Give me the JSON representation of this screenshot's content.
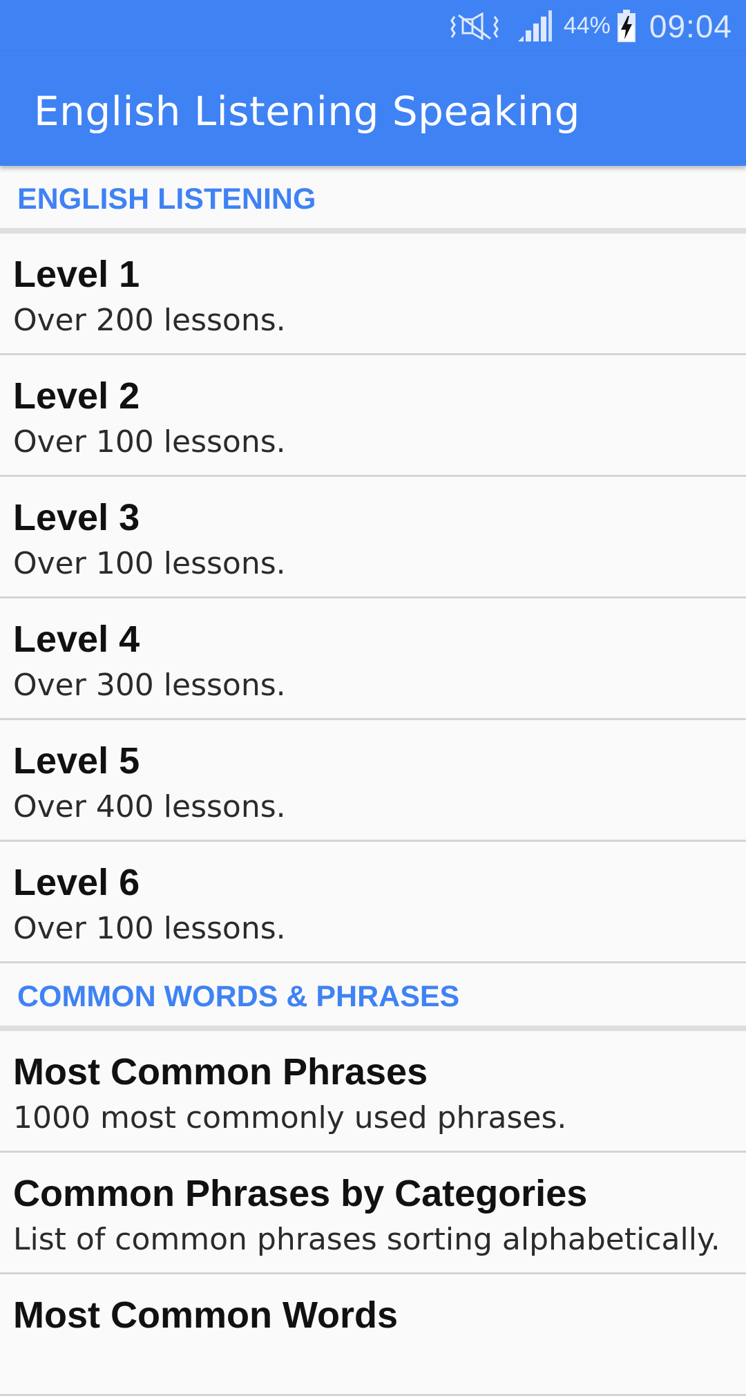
{
  "status_bar": {
    "battery_percent": "44%",
    "time": "09:04",
    "icons": [
      "mute-vibrate-icon",
      "signal-icon",
      "battery-charging-icon"
    ]
  },
  "app_bar": {
    "title": "English Listening Speaking",
    "background_color": "#3f82f4"
  },
  "sections": [
    {
      "header": "ENGLISH LISTENING",
      "items": [
        {
          "title": "Level 1",
          "subtitle": "Over 200 lessons."
        },
        {
          "title": "Level 2",
          "subtitle": "Over 100 lessons."
        },
        {
          "title": "Level 3",
          "subtitle": "Over 100 lessons."
        },
        {
          "title": "Level 4",
          "subtitle": "Over 300 lessons."
        },
        {
          "title": "Level 5",
          "subtitle": "Over 400 lessons."
        },
        {
          "title": "Level 6",
          "subtitle": "Over 100 lessons."
        }
      ]
    },
    {
      "header": "COMMON WORDS & PHRASES",
      "items": [
        {
          "title": "Most Common Phrases",
          "subtitle": "1000 most commonly used phrases."
        },
        {
          "title": "Common Phrases by Categories",
          "subtitle": "List of common phrases sorting alphabetically."
        },
        {
          "title": "Most Common Words",
          "subtitle": ""
        }
      ]
    }
  ],
  "colors": {
    "accent": "#3f82f4",
    "background": "#fafafa",
    "divider": "#d4d4d4"
  }
}
